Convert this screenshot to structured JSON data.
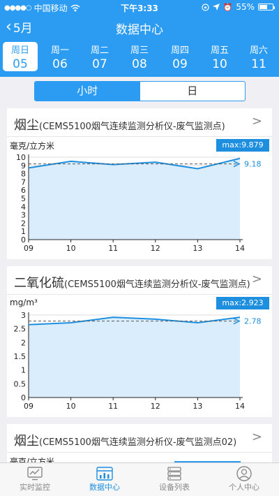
{
  "status": {
    "carrier": "中国移动",
    "time": "下午3:33",
    "battery": "55%",
    "battery_level": 0.55
  },
  "nav": {
    "back_label": "5月",
    "title": "数据中心"
  },
  "week": [
    {
      "weekday": "周日",
      "date": "05",
      "active": true
    },
    {
      "weekday": "周一",
      "date": "06",
      "active": false
    },
    {
      "weekday": "周二",
      "date": "07",
      "active": false
    },
    {
      "weekday": "周三",
      "date": "08",
      "active": false
    },
    {
      "weekday": "周四",
      "date": "09",
      "active": false
    },
    {
      "weekday": "周五",
      "date": "10",
      "active": false
    },
    {
      "weekday": "周六",
      "date": "11",
      "active": false
    }
  ],
  "segment": {
    "options": [
      "小时",
      "日"
    ],
    "selected": "小时"
  },
  "cards": [
    {
      "title_main": "烟尘",
      "title_sub": "(CEMS5100烟气连续监测分析仪-废气监测点)",
      "unit": "毫克/立方米",
      "max_label": "max:9.879",
      "chart_data": {
        "type": "area",
        "x": [
          "09",
          "10",
          "11",
          "12",
          "13",
          "14"
        ],
        "values": [
          8.7,
          9.5,
          9.1,
          9.4,
          8.6,
          9.85
        ],
        "ylim": [
          0,
          10
        ],
        "yticks": [
          "0",
          "1",
          "2",
          "3",
          "4",
          "5",
          "6",
          "7",
          "8",
          "9",
          "10"
        ],
        "average": 9.18,
        "average_label": "9.18",
        "line_color": "#1e8fdf",
        "fill_color": "#d9edfc"
      }
    },
    {
      "title_main": "二氧化硫",
      "title_sub": "(CEMS5100烟气连续监测分析仪-废气监测点)",
      "unit": "mg/m³",
      "max_label": "max:2.923",
      "chart_data": {
        "type": "area",
        "x": [
          "09",
          "10",
          "11",
          "12",
          "13",
          "14"
        ],
        "values": [
          2.65,
          2.72,
          2.92,
          2.85,
          2.72,
          2.92
        ],
        "ylim": [
          0,
          3
        ],
        "yticks": [
          "0",
          "0.5",
          "1",
          "1.5",
          "2",
          "2.5",
          "3"
        ],
        "average": 2.78,
        "average_label": "2.78",
        "line_color": "#1e8fdf",
        "fill_color": "#d9edfc"
      }
    },
    {
      "title_main": "烟尘",
      "title_sub": "(CEMS5100烟气连续监测分析仪-废气监测点02)",
      "unit": "毫克/立方米"
    }
  ],
  "tabs": [
    {
      "label": "实时监控",
      "icon": "monitor-chart-icon",
      "active": false
    },
    {
      "label": "数据中心",
      "icon": "data-center-icon",
      "active": true
    },
    {
      "label": "设备列表",
      "icon": "server-list-icon",
      "active": false
    },
    {
      "label": "个人中心",
      "icon": "user-icon",
      "active": false
    }
  ]
}
